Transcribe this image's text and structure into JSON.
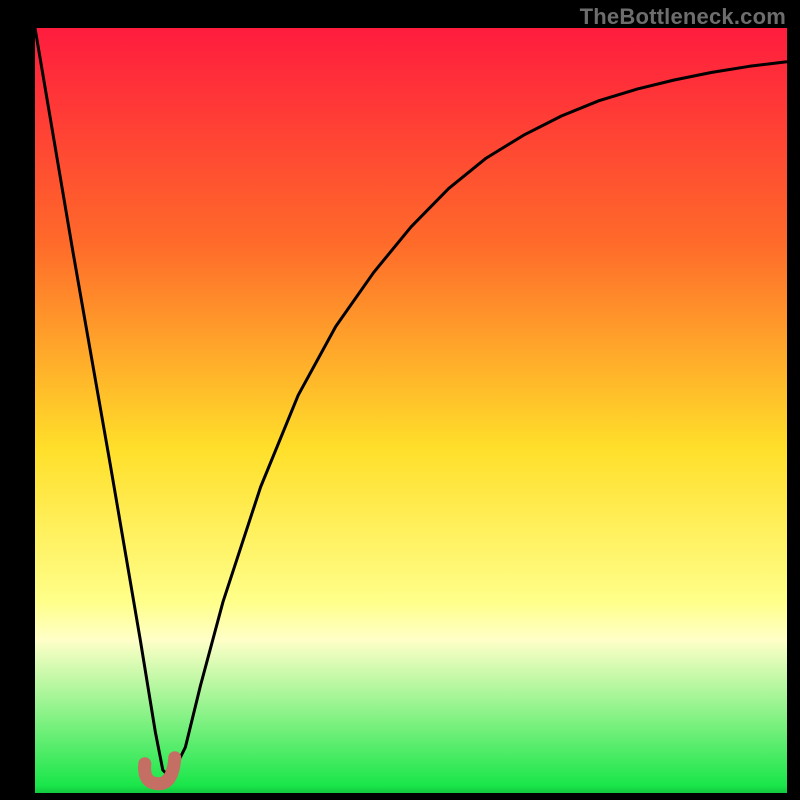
{
  "watermark": "TheBottleneck.com",
  "colors": {
    "top": "#ff1c3e",
    "mid_top": "#ff8a1a",
    "mid": "#ffdf2a",
    "pale": "#ffffa8",
    "green": "#1ae64a",
    "curve": "#000000",
    "marker": "#c56e63",
    "background": "#000000"
  },
  "chart_data": {
    "type": "line",
    "title": "",
    "xlabel": "",
    "ylabel": "",
    "xlim": [
      0,
      100
    ],
    "ylim": [
      0,
      100
    ],
    "series": [
      {
        "name": "bottleneck-curve",
        "x": [
          0,
          5,
          10,
          14,
          16,
          17,
          18,
          20,
          22,
          25,
          30,
          35,
          40,
          45,
          50,
          55,
          60,
          65,
          70,
          75,
          80,
          85,
          90,
          95,
          100
        ],
        "y": [
          100,
          71,
          43,
          20,
          8,
          3,
          2,
          6,
          14,
          25,
          40,
          52,
          61,
          68,
          74,
          79,
          83,
          86,
          88.5,
          90.5,
          92,
          93.2,
          94.2,
          95,
          95.6
        ]
      }
    ],
    "marker": {
      "x": 17,
      "y": 2
    },
    "gradient_bands": [
      {
        "stop": 0,
        "color": "top"
      },
      {
        "stop": 55,
        "color": "mid"
      },
      {
        "stop": 77,
        "color": "pale"
      },
      {
        "stop": 100,
        "color": "green"
      }
    ]
  }
}
